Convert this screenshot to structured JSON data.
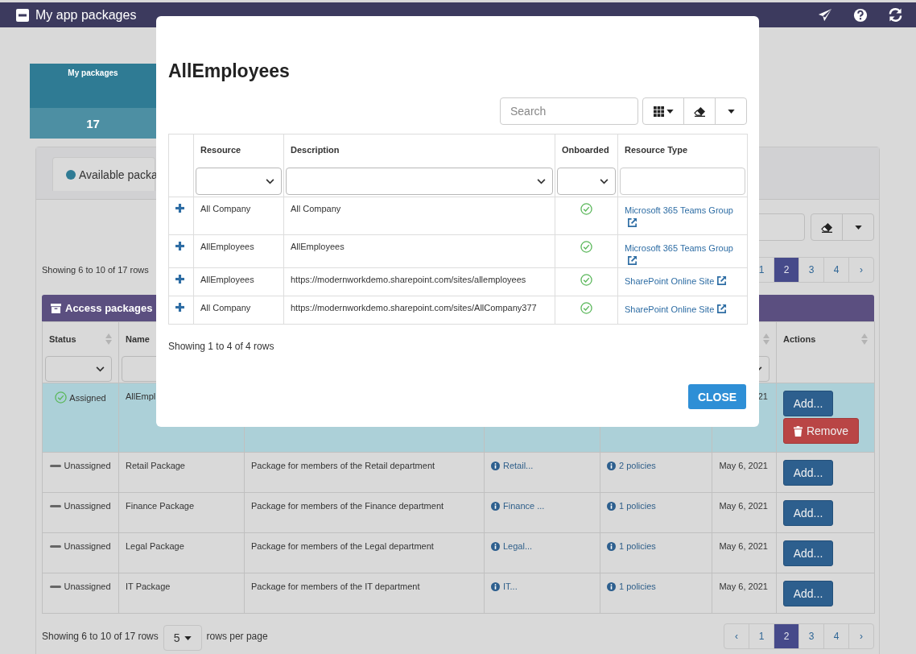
{
  "app_bar": {
    "title": "My app packages"
  },
  "summary_tile": {
    "label": "My packages",
    "count": "17"
  },
  "tabs": [
    {
      "label": "Available packa",
      "selected": true
    }
  ],
  "top_pager": {
    "summary": "Showing 6 to 10 of 17 rows",
    "pages": [
      {
        "label": "1",
        "selected": false
      },
      {
        "label": "2",
        "selected": true
      },
      {
        "label": "3",
        "selected": false
      },
      {
        "label": "4",
        "selected": false
      },
      {
        "label": "›",
        "selected": false
      }
    ]
  },
  "packages_table": {
    "title": "Access packages",
    "columns": [
      {
        "label": "Status",
        "sortable": true,
        "filter": true
      },
      {
        "label": "Name",
        "filter": true
      },
      {},
      {},
      {},
      {
        "sortable": true,
        "filter": true
      },
      {
        "label": "Actions",
        "sortable": true
      }
    ],
    "rows": [
      {
        "selected": true,
        "assigned": true,
        "status": "Assigned",
        "name": "AllEmpl",
        "date": "21",
        "actions": [
          {
            "kind": "add",
            "label": "Add..."
          },
          {
            "kind": "remove",
            "label": "Remove"
          }
        ]
      },
      {
        "selected": false,
        "assigned": false,
        "status": "Unassigned",
        "name": "Retail Package",
        "description": "Package for members of the Retail department",
        "column_4": "Retail...",
        "policies": "2 policies",
        "date": "May 6, 2021",
        "actions": [
          {
            "kind": "add",
            "label": "Add..."
          }
        ]
      },
      {
        "selected": false,
        "assigned": false,
        "status": "Unassigned",
        "name": "Finance Package",
        "description": "Package for members of the Finance department",
        "column_4": "Finance ...",
        "policies": "1 policies",
        "date": "May 6, 2021",
        "actions": [
          {
            "kind": "add",
            "label": "Add..."
          }
        ]
      },
      {
        "selected": false,
        "assigned": false,
        "status": "Unassigned",
        "name": "Legal Package",
        "description": "Package for members of the Legal department",
        "column_4": "Legal...",
        "policies": "1 policies",
        "date": "May 6, 2021",
        "actions": [
          {
            "kind": "add",
            "label": "Add..."
          }
        ]
      },
      {
        "selected": false,
        "assigned": false,
        "status": "Unassigned",
        "name": "IT Package",
        "description": "Package for members of the IT department",
        "column_4": "IT...",
        "policies": "1 policies",
        "date": "May 6, 2021",
        "actions": [
          {
            "kind": "add",
            "label": "Add..."
          }
        ]
      }
    ]
  },
  "bottom_pager": {
    "summary": "Showing 6 to 10 of 17 rows",
    "page_size": "5",
    "page_size_suffix": "rows per page",
    "pages": [
      {
        "label": "‹",
        "selected": false
      },
      {
        "label": "1",
        "selected": false
      },
      {
        "label": "2",
        "selected": true
      },
      {
        "label": "3",
        "selected": false
      },
      {
        "label": "4",
        "selected": false
      },
      {
        "label": "›",
        "selected": false
      }
    ]
  },
  "dialog": {
    "title": "AllEmployees",
    "search": {
      "placeholder": "Search"
    },
    "columns": [
      "Resource",
      "Description",
      "Onboarded",
      "Resource Type"
    ],
    "rows": [
      {
        "resource": "All Company",
        "description": "All Company",
        "onboarded": true,
        "resource_type": "Microsoft 365 Teams Group"
      },
      {
        "resource": "AllEmployees",
        "description": "AllEmployees",
        "onboarded": true,
        "resource_type": "Microsoft 365 Teams Group"
      },
      {
        "resource": "AllEmployees",
        "description": "https://modernworkdemo.sharepoint.com/sites/allemployees",
        "onboarded": true,
        "resource_type": "SharePoint Online Site"
      },
      {
        "resource": "All Company",
        "description": "https://modernworkdemo.sharepoint.com/sites/AllCompany377",
        "onboarded": true,
        "resource_type": "SharePoint Online Site"
      }
    ],
    "summary": "Showing 1 to 4 of 4 rows",
    "close": "CLOSE"
  }
}
